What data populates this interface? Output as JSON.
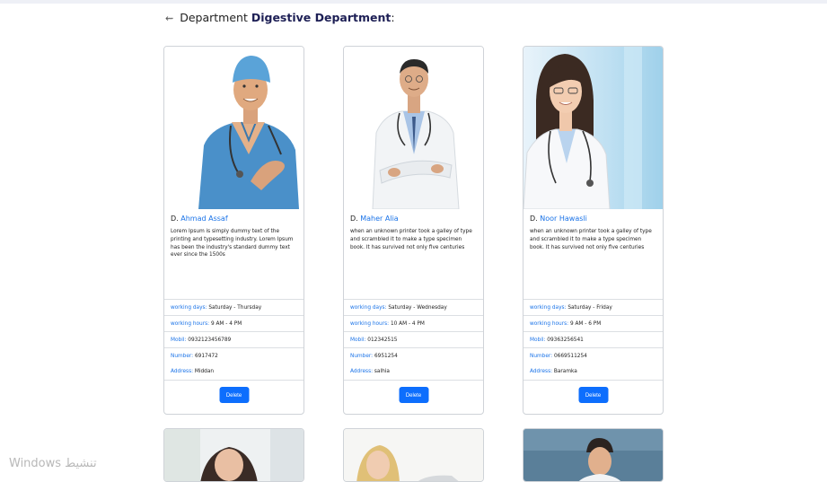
{
  "header": {
    "prefix": "Department",
    "department_name": "Digestive Department",
    "suffix": ":"
  },
  "labels": {
    "working_days": "working days:",
    "working_hours": "working hours:",
    "mobil": "Mobil:",
    "number": "Number:",
    "address": "Address:",
    "delete": "Delete"
  },
  "doctors": [
    {
      "prefix": "D.",
      "name": "Ahmad Assaf",
      "description": "Lorem Ipsum is simply dummy text of the printing and typesetting industry. Lorem Ipsum has been the industry's standard dummy text ever since the 1500s",
      "working_days": "Saturday - Thursday",
      "working_hours": "9 AM - 4 PM",
      "mobil": "0932123456789",
      "number": "6917472",
      "address": "Middan"
    },
    {
      "prefix": "D.",
      "name": "Maher Alia",
      "description": "when an unknown printer took a galley of type and scrambled it to make a type specimen book. It has survived not only five centuries",
      "working_days": "Saturday - Wednesday",
      "working_hours": "10 AM - 4 PM",
      "mobil": "012342515",
      "number": "6951254",
      "address": "salhia"
    },
    {
      "prefix": "D.",
      "name": "Noor Hawasli",
      "description": "when an unknown printer took a galley of type and scrambled it to make a type specimen book. It has survived not only five centuries",
      "working_days": "Saturday - Friday",
      "working_hours": "9 AM - 6 PM",
      "mobil": "09363256541",
      "number": "0669511254",
      "address": "Baramka"
    }
  ],
  "watermark": "Windows تنشيط",
  "colors": {
    "link_blue": "#1a73e8",
    "button_blue": "#0d6efd",
    "heading_navy": "#1d1f55"
  }
}
